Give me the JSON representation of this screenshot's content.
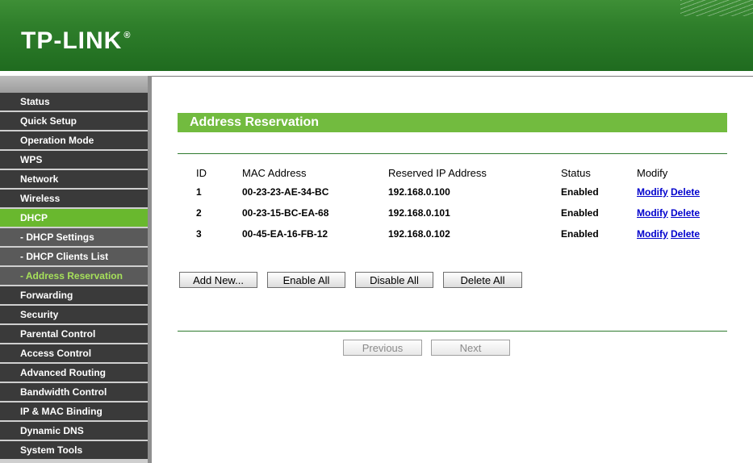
{
  "brand": {
    "logo": "TP-LINK",
    "reg": "®"
  },
  "sidebar": {
    "items": [
      {
        "label": "Status"
      },
      {
        "label": "Quick Setup"
      },
      {
        "label": "Operation Mode"
      },
      {
        "label": "WPS"
      },
      {
        "label": "Network"
      },
      {
        "label": "Wireless"
      },
      {
        "label": "DHCP"
      },
      {
        "label": "- DHCP Settings"
      },
      {
        "label": "- DHCP Clients List"
      },
      {
        "label": "- Address Reservation"
      },
      {
        "label": "Forwarding"
      },
      {
        "label": "Security"
      },
      {
        "label": "Parental Control"
      },
      {
        "label": "Access Control"
      },
      {
        "label": "Advanced Routing"
      },
      {
        "label": "Bandwidth Control"
      },
      {
        "label": "IP & MAC Binding"
      },
      {
        "label": "Dynamic DNS"
      },
      {
        "label": "System Tools"
      }
    ]
  },
  "main": {
    "title": "Address Reservation",
    "table": {
      "headers": {
        "id": "ID",
        "mac": "MAC Address",
        "ip": "Reserved IP Address",
        "status": "Status",
        "modify": "Modify"
      },
      "rows": [
        {
          "id": "1",
          "mac": "00-23-23-AE-34-BC",
          "ip": "192.168.0.100",
          "status": "Enabled",
          "modify": "Modify",
          "delete": "Delete"
        },
        {
          "id": "2",
          "mac": "00-23-15-BC-EA-68",
          "ip": "192.168.0.101",
          "status": "Enabled",
          "modify": "Modify",
          "delete": "Delete"
        },
        {
          "id": "3",
          "mac": "00-45-EA-16-FB-12",
          "ip": "192.168.0.102",
          "status": "Enabled",
          "modify": "Modify",
          "delete": "Delete"
        }
      ]
    },
    "buttons": {
      "add_new": "Add New...",
      "enable_all": "Enable All",
      "disable_all": "Disable All",
      "delete_all": "Delete All"
    },
    "pager": {
      "previous": "Previous",
      "next": "Next"
    }
  },
  "colors": {
    "header_green": "#2f7f2b",
    "active_green": "#69b82e",
    "title_green": "#72bb3f",
    "menu_dark": "#3a3a3a",
    "menu_sub": "#5a5a5a",
    "current_text": "#a6e05a",
    "link": "#0000cc"
  }
}
